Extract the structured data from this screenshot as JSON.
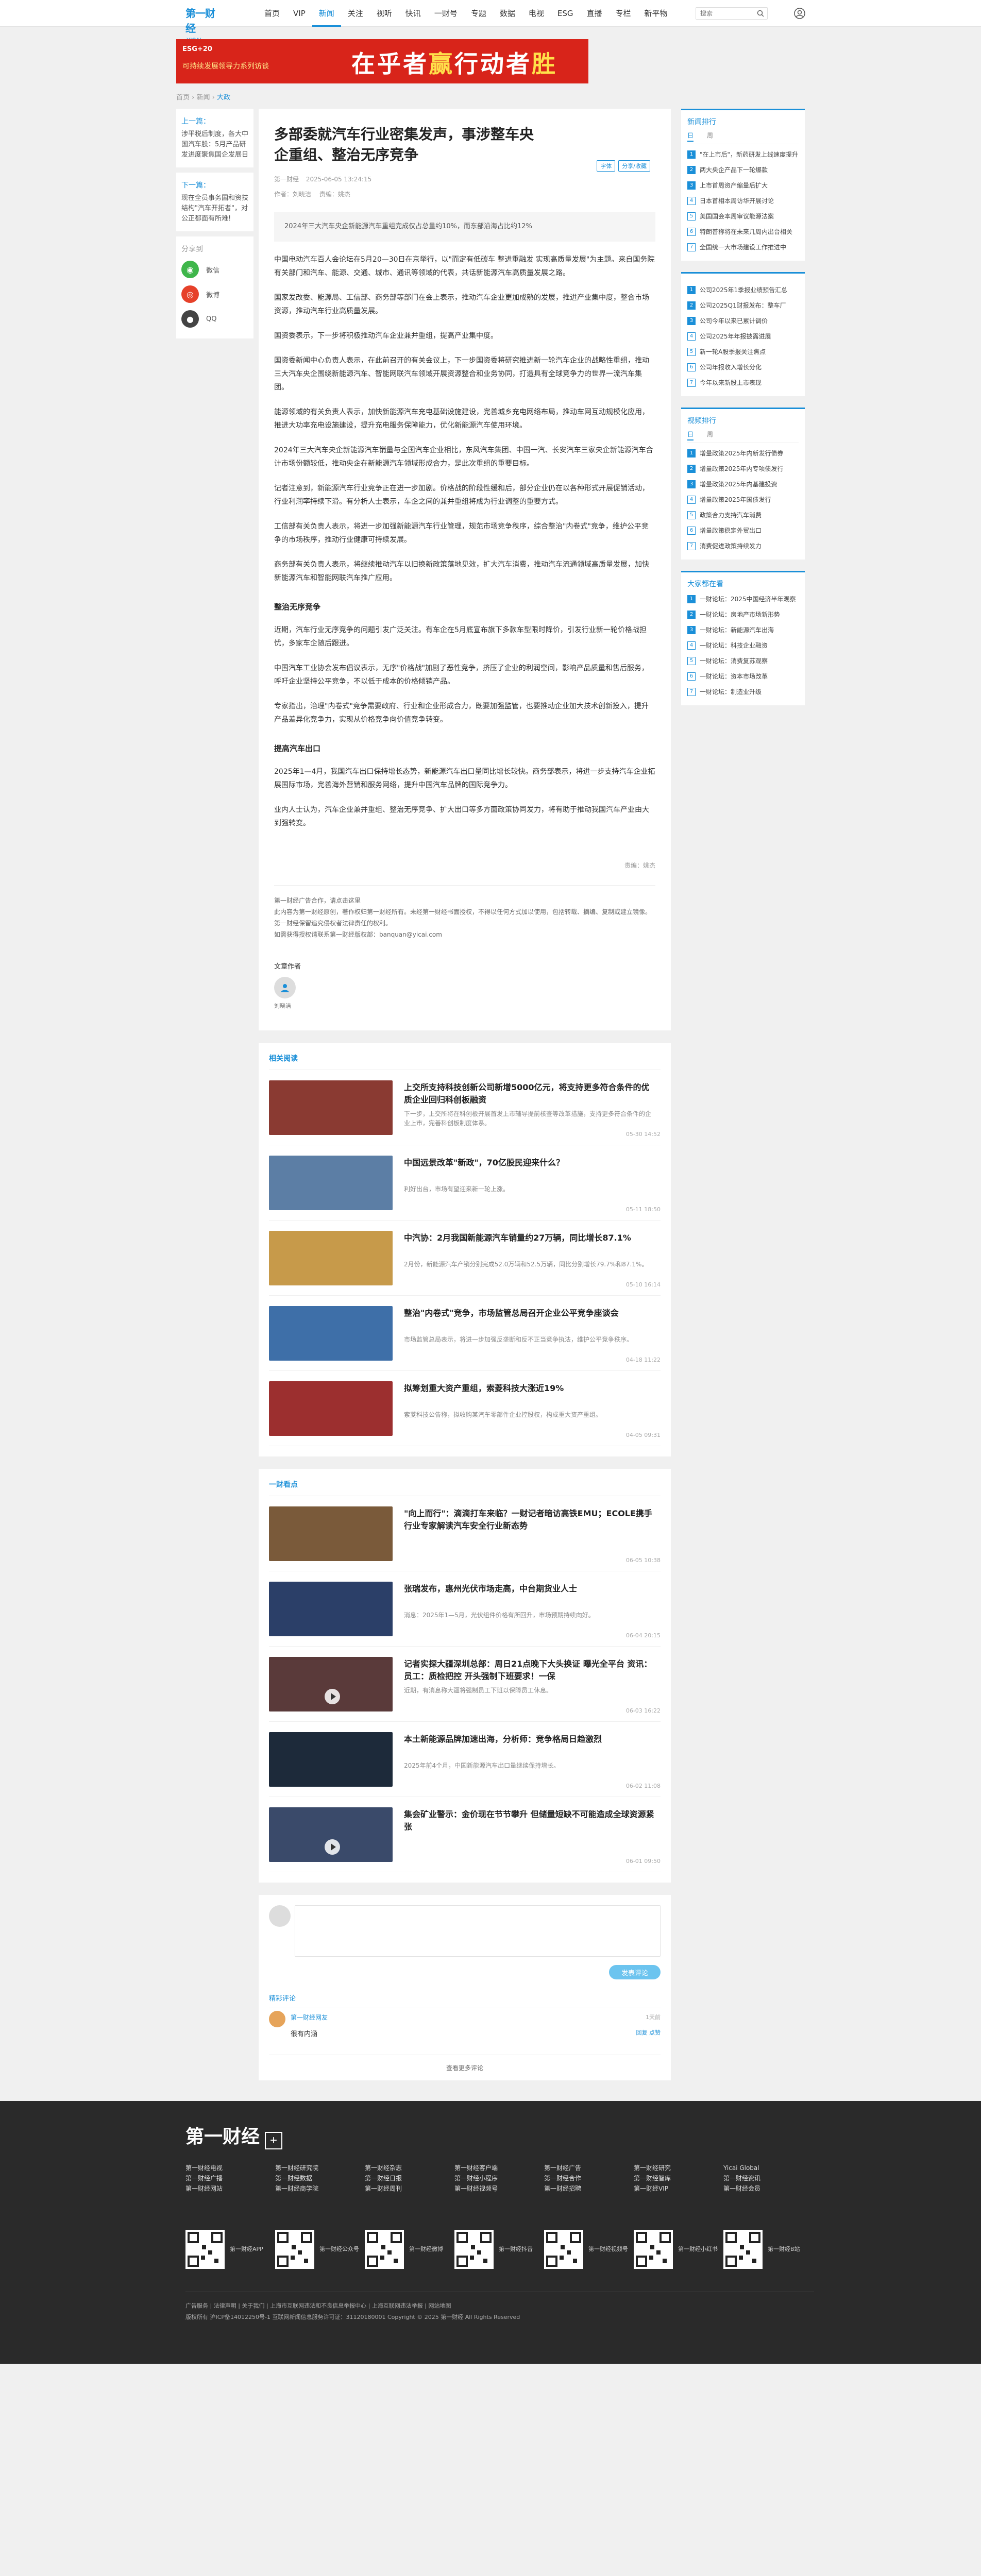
{
  "nav": {
    "logo_main": "第一财经",
    "logo_sub": "YICAI",
    "items": [
      "首页",
      "VIP",
      "新闻",
      "关注",
      "视听",
      "快讯",
      "一财号",
      "专题",
      "数据",
      "电视",
      "ESG",
      "直播",
      "专栏",
      "新平物"
    ],
    "active": "新闻",
    "search_placeholder": "搜索",
    "search_icon": "search-icon",
    "user_icon": "user-icon"
  },
  "banner": {
    "line1": "ESG+20",
    "line2": "可持续发展领导力系列访谈",
    "slogan_a": "在乎者",
    "slogan_b": "赢",
    "slogan_c": "行动者",
    "slogan_d": "胜"
  },
  "breadcrumb": {
    "home": "首页",
    "sep1": "›",
    "section": "新闻",
    "sep2": "›",
    "current": "大政"
  },
  "left": {
    "prev_label": "上一篇：",
    "prev_title": "涉平税后制度，各大中国汽车股：5月产品研发进度聚焦国企发展日",
    "next_label": "下一篇：",
    "next_title": "现在全员事务国和资技结构\"汽车开拓者\"，对公正都面有所难!",
    "share_label": "分享到",
    "share": [
      "微信",
      "微博",
      "QQ"
    ]
  },
  "article": {
    "title": "多部委就汽车行业密集发声，事涉整车央企重组、整治无序竞争",
    "source": "第一财经",
    "date": "2025-06-05 13:24:15",
    "author_line": "作者：刘晓洁  　责编：姚杰",
    "btn_font": "字体",
    "btn_share": "分享/收藏",
    "summary": "2024年三大汽车央企新能源汽车重组完成仅占总量约10%，而东部沿海占比约12%",
    "paragraphs": [
      "中国电动汽车百人会论坛在5月20—30日在京举行，以\"而定有低碳车 整进重融发 实现高质量发展\"为主题。来自国务院有关部门和汽车、能源、交通、城市、通讯等领域的代表，共话新能源汽车高质量发展之路。",
      "国家发改委、能源局、工信部、商务部等部门在会上表示，推动汽车企业更加成熟的发展，推进产业集中度，整合市场资源，推动汽车行业高质量发展。",
      "国资委表示，下一步将积极推动汽车企业兼并重组，提高产业集中度。",
      "国资委新闻中心负责人表示，在此前召开的有关会议上，下一步国资委将研究推进新一轮汽车企业的战略性重组，推动三大汽车央企围绕新能源汽车、智能网联汽车领域开展资源整合和业务协同，打造具有全球竞争力的世界一流汽车集团。",
      "能源领域的有关负责人表示，加快新能源汽车充电基础设施建设，完善城乡充电网络布局，推动车网互动规模化应用，推进大功率充电设施建设，提升充电服务保障能力，优化新能源汽车使用环境。",
      "2024年三大汽车央企新能源汽车销量与全国汽车企业相比，东风汽车集团、中国一汽、长安汽车三家央企新能源汽车合计市场份额较低，推动央企在新能源汽车领域形成合力，是此次重组的重要目标。",
      "记者注意到，新能源汽车行业竞争正在进一步加剧。价格战的阶段性缓和后，部分企业仍在以各种形式开展促销活动，行业利润率持续下滑。有分析人士表示，车企之间的兼并重组将成为行业调整的重要方式。",
      "工信部有关负责人表示，将进一步加强新能源汽车行业管理，规范市场竞争秩序，综合整治\"内卷式\"竞争，维护公平竞争的市场秩序，推动行业健康可持续发展。",
      "商务部有关负责人表示，将继续推动汽车以旧换新政策落地见效，扩大汽车消费，推动汽车流通领域高质量发展，加快新能源汽车和智能网联汽车推广应用。"
    ],
    "section_headings": [
      "整治无序竞争"
    ],
    "more_paragraphs": [
      "近期，汽车行业无序竞争的问题引发广泛关注。有车企在5月底宣布旗下多款车型限时降价，引发行业新一轮价格战担忧，多家车企随后跟进。",
      "中国汽车工业协会发布倡议表示，无序\"价格战\"加剧了恶性竞争，挤压了企业的利润空间，影响产品质量和售后服务，呼吁企业坚持公平竞争，不以低于成本的价格倾销产品。",
      "专家指出，治理\"内卷式\"竞争需要政府、行业和企业形成合力，既要加强监管，也要推动企业加大技术创新投入，提升产品差异化竞争力，实现从价格竞争向价值竞争转变。"
    ],
    "section_headings_2": [
      "提高汽车出口"
    ],
    "final_paragraphs": [
      "2025年1—4月，我国汽车出口保持增长态势，新能源汽车出口量同比增长较快。商务部表示，将进一步支持汽车企业拓展国际市场，完善海外营销和服务网络，提升中国汽车品牌的国际竞争力。",
      "业内人士认为，汽车企业兼并重组、整治无序竞争、扩大出口等多方面政策协同发力，将有助于推动我国汽车产业由大到强转变。"
    ],
    "editor": "责编：姚杰",
    "declaration": [
      "第一财经广告合作，请点击这里",
      "此内容为第一财经原创，著作权归第一财经所有。未经第一财经书面授权，不得以任何方式加以使用，包括转载、摘编、复制或建立镜像。第一财经保留追究侵权者法律责任的权利。",
      "如需获得授权请联系第一财经版权部：banquan@yicai.com"
    ],
    "author_section_label": "文章作者",
    "author_name": "刘晓洁"
  },
  "related": {
    "heading": "相关阅读",
    "items": [
      {
        "title": "上交所支持科技创新公司新增5000亿元，将支持更多符合条件的优质企业回归科创板融资",
        "desc": "下一步，上交所将在科创板开展首发上市辅导提前核查等改革措施，支持更多符合条件的企业上市，完善科创板制度体系。",
        "time": "05-30 14:52",
        "thumb": "#8a3a32"
      },
      {
        "title": "中国远景改革\"新政\"，70亿股民迎来什么？",
        "desc": "利好出台，市场有望迎来新一轮上涨。",
        "time": "05-11 18:50",
        "thumb": "#5c7ea5"
      },
      {
        "title": "中汽协：2月我国新能源汽车销量约27万辆，同比增长87.1%",
        "desc": "2月份，新能源汽车产销分别完成52.0万辆和52.5万辆，同比分别增长79.7%和87.1%。",
        "time": "05-10 16:14",
        "thumb": "#c79a4a"
      },
      {
        "title": "整治\"内卷式\"竞争，市场监管总局召开企业公平竞争座谈会",
        "desc": "市场监管总局表示，将进一步加强反垄断和反不正当竞争执法，维护公平竞争秩序。",
        "time": "04-18 11:22",
        "thumb": "#3e6fa8"
      },
      {
        "title": "拟筹划重大资产重组，索菱科技大涨近19%",
        "desc": "索菱科技公告称，拟收购某汽车零部件企业控股权，构成重大资产重组。",
        "time": "04-05 09:31",
        "thumb": "#9c2f2f"
      }
    ]
  },
  "videos": {
    "heading": "一财看点",
    "items": [
      {
        "title": "\"向上而行\"：滴滴打车来临？一财记者暗访高铁EMU；ECOLE携手行业专家解读汽车安全行业新态势",
        "desc": "",
        "time": "06-05 10:38",
        "thumb": "#7a5a3a",
        "play": false
      },
      {
        "title": "张瑞发布，惠州光伏市场走高，中台期货业人士",
        "desc": "消息：2025年1—5月，光伏组件价格有所回升，市场预期持续向好。",
        "time": "06-04 20:15",
        "thumb": "#2b3f68",
        "play": false
      },
      {
        "title": "记者实探大疆深圳总部：周日21点晚下大头换证 曝光全平台 资讯：员工：质检把控 开头强制下班要求！一保",
        "desc": "近期，有消息称大疆将强制员工下班以保障员工休息。",
        "time": "06-03 16:22",
        "thumb": "#5a3a3a",
        "play": true
      },
      {
        "title": "本土新能源品牌加速出海，分析师：竞争格局日趋激烈",
        "desc": "2025年前4个月，中国新能源汽车出口量继续保持增长。",
        "time": "06-02 11:08",
        "thumb": "#1d2a3a",
        "play": false
      },
      {
        "title": "集会矿业警示：金价现在节节攀升 但储量短缺不可能造成全球资源紧张",
        "desc": "",
        "time": "06-01 09:50",
        "thumb": "#3a4a6a",
        "play": true
      }
    ]
  },
  "comments": {
    "placeholder": "",
    "submit": "发表评论",
    "heading": "精彩评论",
    "user": "第一财经网友",
    "text": "很有内涵",
    "time": "1天前",
    "reply": "回复 点赞",
    "more": "查看更多评论"
  },
  "rank1": {
    "heading": "新闻排行",
    "tabs": [
      "日",
      "周"
    ],
    "items": [
      "\"在上市后\"，新药研发上线速度提升",
      "两大央企产品下一轮爆款",
      "上市首周资产缩量后扩大",
      "日本首相本周访华开展讨论",
      "美国国会本周审议能源法案",
      "特朗普称将在未来几周内出台相关",
      "全国统一大市场建设工作推进中"
    ]
  },
  "rank2": {
    "heading": "",
    "items": [
      "公司2025年1季报业绩预告汇总",
      "公司2025Q1财报发布：整车厂",
      "公司今年以来已累计调价",
      "公司2025年年报披露进展",
      "新一轮A股季报关注焦点",
      "公司年报收入增长分化",
      "今年以来新股上市表现"
    ]
  },
  "rank3": {
    "heading": "视频排行",
    "tabs": [
      "日",
      "周"
    ],
    "items": [
      "增量政策2025年内新发行债券",
      "增量政策2025年内专项债发行",
      "增量政策2025年内基建投资",
      "增量政策2025年国债发行",
      "政策合力支持汽车消费",
      "增量政策稳定外贸出口",
      "消费促进政策持续发力"
    ]
  },
  "rank4": {
    "heading": "大家都在看",
    "items": [
      "一财论坛：2025中国经济半年观察",
      "一财论坛：房地产市场新形势",
      "一财论坛：新能源汽车出海",
      "一财论坛：科技企业融资",
      "一财论坛：消费复苏观察",
      "一财论坛：资本市场改革",
      "一财论坛：制造业升级"
    ]
  },
  "footer": {
    "logo": "第一财经",
    "cols": [
      [
        "第一财经电视",
        "第一财经广播",
        "第一财经网站"
      ],
      [
        "第一财经研究院",
        "第一财经数据",
        "第一财经商学院"
      ],
      [
        "第一财经杂志",
        "第一财经日报",
        "第一财经周刊"
      ],
      [
        "第一财经客户端",
        "第一财经小程序",
        "第一财经视频号"
      ],
      [
        "第一财经广告",
        "第一财经合作",
        "第一财经招聘"
      ],
      [
        "第一财经研究",
        "第一财经智库",
        "第一财经VIP"
      ],
      [
        "Yicai Global",
        "第一财经资讯",
        "第一财经会员"
      ]
    ],
    "qrs": [
      "第一财经APP",
      "第一财经公众号",
      "第一财经微博",
      "第一财经抖音",
      "第一财经视频号",
      "第一财经小红书",
      "第一财经B站"
    ],
    "links": "广告服务 | 法律声明 | 关于我们 | 上海市互联网违法和不良信息举报中心 | 上海互联网违法举报 | 网站地图",
    "copyright": "版权所有 沪ICP备14012250号-1 互联网新闻信息服务许可证：31120180001 Copyright © 2025 第一财经 All Rights Reserved"
  }
}
